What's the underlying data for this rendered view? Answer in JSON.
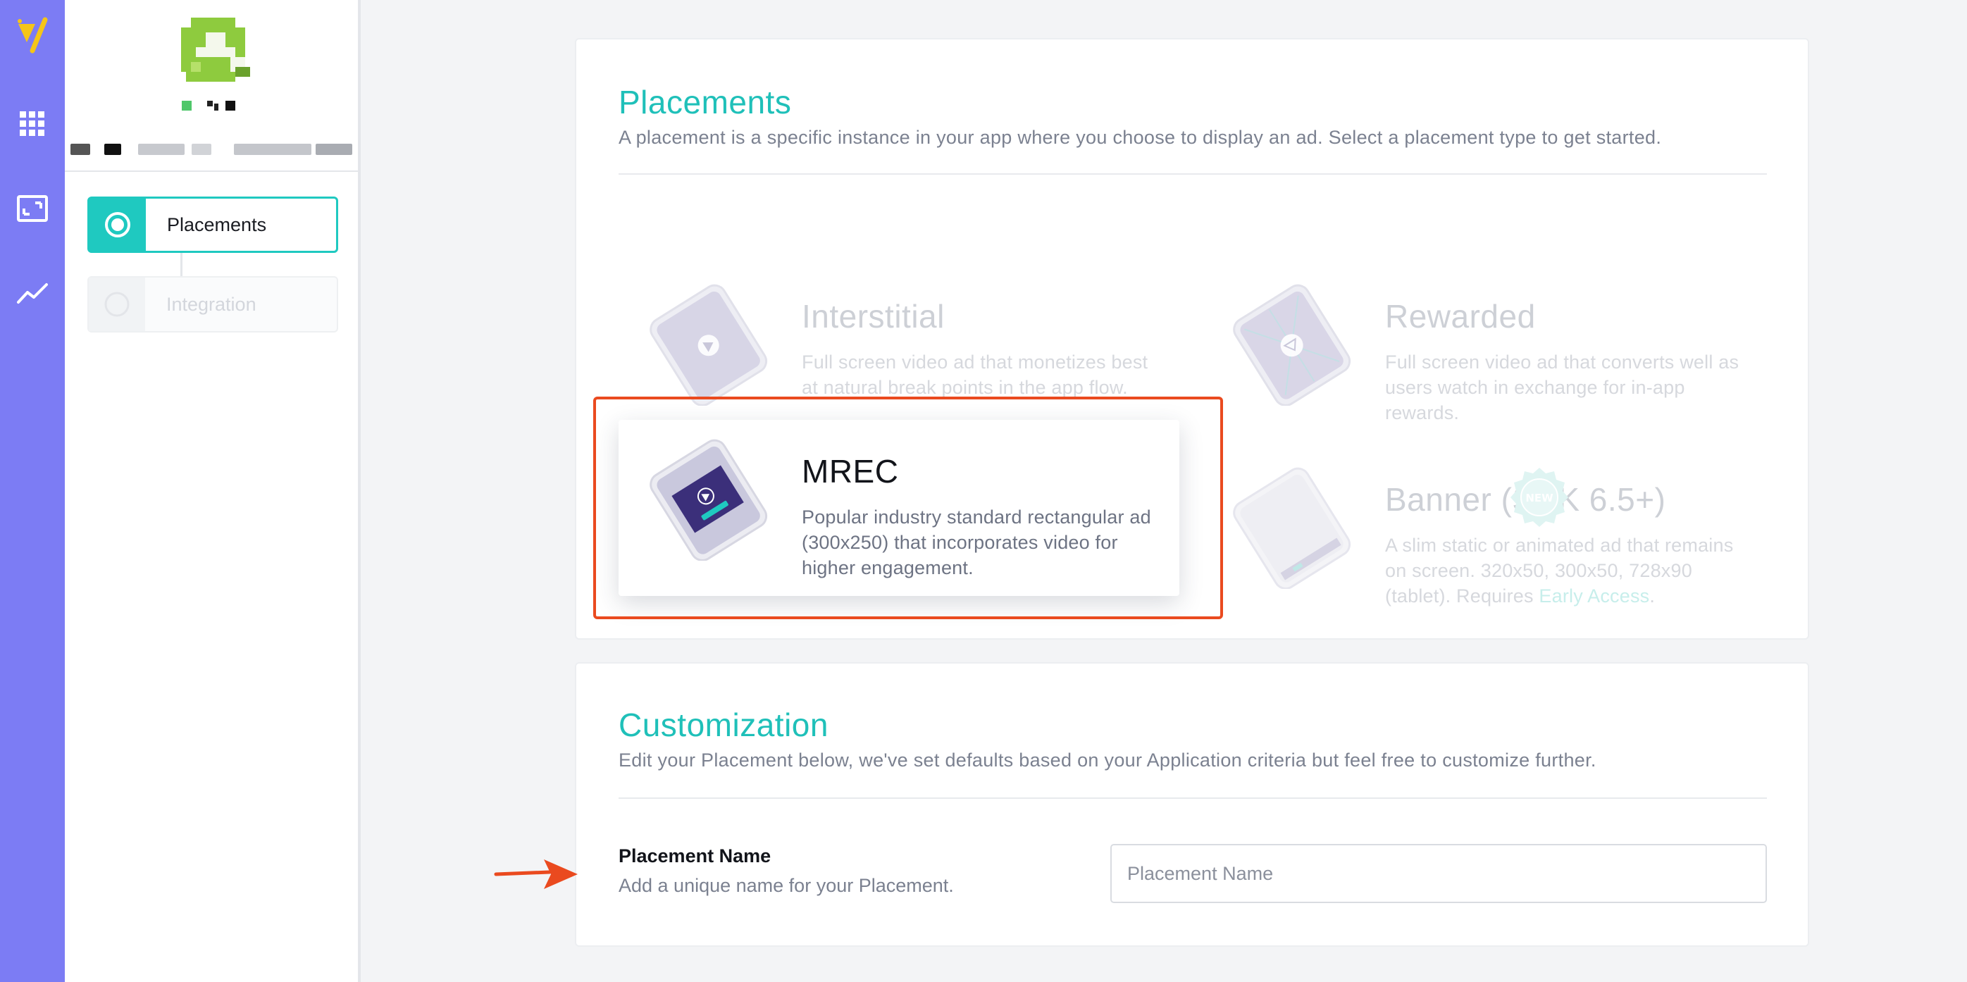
{
  "rail": {
    "items": [
      {
        "name": "logo",
        "icon": "vungle-logo-icon"
      },
      {
        "name": "apps",
        "icon": "grid-icon"
      },
      {
        "name": "placements",
        "icon": "frame-icon"
      },
      {
        "name": "reports",
        "icon": "trend-line-icon"
      }
    ],
    "color": "#7c7cf4"
  },
  "sidebar": {
    "steps": [
      {
        "label": "Placements",
        "state": "active"
      },
      {
        "label": "Integration",
        "state": "inactive"
      }
    ]
  },
  "placements": {
    "title": "Placements",
    "description": "A placement is a specific instance in your app where you choose to display an ad. Select a placement type to get started.",
    "types": [
      {
        "id": "interstitial",
        "title": "Interstitial",
        "description": "Full screen video ad that monetizes best at natural break points in the app flow.",
        "state": "faded"
      },
      {
        "id": "rewarded",
        "title": "Rewarded",
        "description": "Full screen video ad that converts well as users watch in exchange for in-app rewards.",
        "state": "faded"
      },
      {
        "id": "mrec",
        "title": "MREC",
        "description": "Popular industry standard rectangular ad (300x250) that incorporates video for higher engagement.",
        "state": "selected"
      },
      {
        "id": "banner",
        "title": "Banner (SDK 6.5+)",
        "description": "A slim static or animated ad that remains on screen. 320x50, 300x50, 728x90 (tablet). Requires",
        "link": "Early Access",
        "link_suffix": ".",
        "badge": "NEW",
        "state": "faded"
      }
    ]
  },
  "customization": {
    "title": "Customization",
    "description": "Edit your Placement below, we've set defaults based on your Application criteria but feel free to customize further.",
    "field_label": "Placement Name",
    "field_help": "Add a unique name for your Placement.",
    "input_placeholder": "Placement Name",
    "input_value": ""
  },
  "colors": {
    "accent": "#1fc0b9",
    "highlight": "#ea4a1f"
  }
}
